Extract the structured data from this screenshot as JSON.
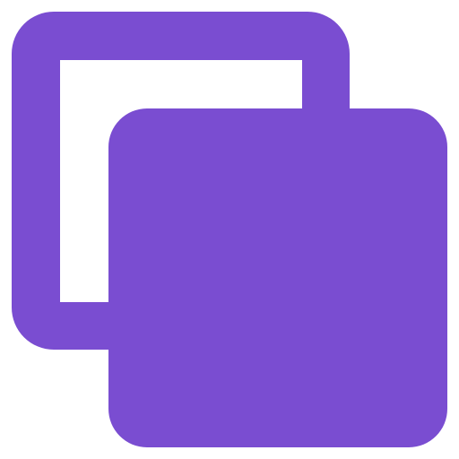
{
  "icon": {
    "name": "copy-icon",
    "color": "#7a4dd1"
  }
}
